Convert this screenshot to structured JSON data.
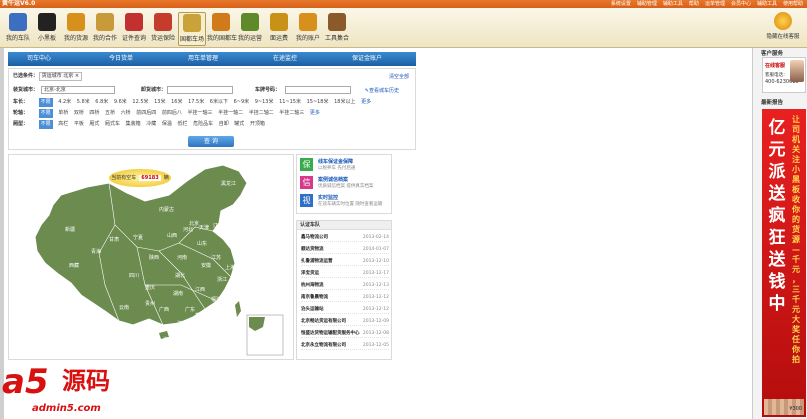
{
  "window": {
    "title": "黄牛运V6.0",
    "menus": [
      "系统设置",
      "辅助管理",
      "辅助工具",
      "帮助",
      "运单管理",
      "会员中心",
      "辅助工具",
      "使用帮助"
    ]
  },
  "toolbar": {
    "items": [
      {
        "label": "我的车队",
        "icon": "truck-team-icon",
        "color": "#3c6fc2"
      },
      {
        "label": "小黑板",
        "icon": "blackboard-icon",
        "color": "#222222"
      },
      {
        "label": "我的货源",
        "icon": "cargo-icon",
        "color": "#d8901c"
      },
      {
        "label": "我的合作",
        "icon": "handshake-icon",
        "color": "#c89a3a"
      },
      {
        "label": "证件查询",
        "icon": "certificate-icon",
        "color": "#c33030"
      },
      {
        "label": "货运保险",
        "icon": "insurance-icon",
        "color": "#c63c2c"
      },
      {
        "label": "国都车场",
        "icon": "parking-icon",
        "color": "#c9a23a"
      },
      {
        "label": "我的国都车",
        "icon": "truck-icon",
        "color": "#d07a1a"
      },
      {
        "label": "我的运营",
        "icon": "operation-icon",
        "color": "#5f8a2a"
      },
      {
        "label": "面运费",
        "icon": "freight-icon",
        "color": "#c89218"
      },
      {
        "label": "我的账户",
        "icon": "account-icon",
        "color": "#d8901c"
      },
      {
        "label": "工具集合",
        "icon": "tools-icon",
        "color": "#8a5a2a"
      }
    ],
    "favorite_label": "隐藏在线客服"
  },
  "tabs": [
    {
      "label": "司车中心",
      "active": false
    },
    {
      "label": "今日货单",
      "active": false
    },
    {
      "label": "用车单管理",
      "active": false
    },
    {
      "label": "在途监控",
      "active": false
    },
    {
      "label": "保证金账户",
      "active": false
    }
  ],
  "filter": {
    "selected_label": "已选条件：",
    "chips": [
      "货运城市",
      "北京"
    ],
    "clear_label": "清空全部",
    "history_label": "查看城车历史",
    "from_label": "装货城市：",
    "from_value": "北京-北京",
    "to_label": "卸货城市：",
    "length_label": "车长：",
    "lengths": [
      "不限",
      "4.2米",
      "5.8米",
      "6.8米",
      "9.6米",
      "12.5米",
      "13米",
      "16米",
      "17.5米",
      "6米以下",
      "6~9米",
      "9~13米",
      "11~15米",
      "15~18米",
      "18米以上"
    ],
    "axle_label": "轮轴：",
    "axles": [
      "不限",
      "单桥",
      "双桥",
      "四桥",
      "五桥",
      "六桥",
      "前四后四",
      "前四后八",
      "半挂一轴三",
      "半挂一轴二",
      "半挂二轴二",
      "半挂二轴三"
    ],
    "body_label": "厢型：",
    "bodies": [
      "不限",
      "高栏",
      "平板",
      "厢式",
      "厢式车",
      "集装箱",
      "冷藏",
      "保温",
      "低栏",
      "危险品车",
      "自卸",
      "罐式",
      "开顶箱"
    ],
    "more_label": "更多",
    "plate_label": "车牌号码：",
    "query_label": "查 询"
  },
  "map": {
    "bubble_prefix": "当前有空车",
    "bubble_count": "69183",
    "bubble_suffix": "辆",
    "land_color": "#6c8b4e",
    "sea_color": "#ffffff",
    "provinces": [
      "新疆",
      "西藏",
      "青海",
      "甘肃",
      "内蒙古",
      "黑龙江",
      "吉林",
      "辽宁",
      "宁夏",
      "陕西",
      "山西",
      "河北",
      "北京",
      "天津",
      "山东",
      "河南",
      "江苏",
      "安徽",
      "湖北",
      "四川",
      "重庆",
      "湖南",
      "江西",
      "浙江",
      "上海",
      "福建",
      "台湾",
      "广东",
      "广西",
      "云南",
      "贵州",
      "海南",
      "香港",
      "澳门"
    ]
  },
  "services": [
    {
      "badge": "保",
      "badge_color": "#3aaa4a",
      "title": "线车保证金保障",
      "desc": "以税养车  先付后通"
    },
    {
      "badge": "信",
      "badge_color": "#d63a8a",
      "title": "案例诚信档案",
      "desc": "优质诚信档案  提供真实档案"
    },
    {
      "badge": "视",
      "badge_color": "#2f6fc8",
      "title": "实时监控",
      "desc": "在途车辆实时位置  随时查看运输"
    }
  ],
  "cert": {
    "header": "认证车队",
    "rows": [
      {
        "name": "鑫马物流公司",
        "date": "2013-02-14"
      },
      {
        "name": "顺达货物流",
        "date": "2014-01-07"
      },
      {
        "name": "扎鲁浦物流运营",
        "date": "2013-12-10"
      },
      {
        "name": "泽宝货运",
        "date": "2013-12-17"
      },
      {
        "name": "杭州海物流",
        "date": "2013-12-13"
      },
      {
        "name": "南京鲁晨物流",
        "date": "2013-12-12"
      },
      {
        "name": "泊头运输站",
        "date": "2013-12-12"
      },
      {
        "name": "北京畅达货运有限公司",
        "date": "2013-12-09"
      },
      {
        "name": "恒盛达货物运输配货服务中心",
        "date": "2013-12-08"
      },
      {
        "name": "北京永立物流有限公司",
        "date": "2013-12-05"
      }
    ]
  },
  "right": {
    "service_header": "客户服务",
    "service_online": "在线客服",
    "service_phone_label": "客服电话：",
    "service_phone": "400-6230018",
    "news_header": "最新报告",
    "ad_big": [
      "亿",
      "元",
      "派",
      "送",
      "疯",
      "狂",
      "送",
      "钱",
      "中"
    ],
    "ad_small": [
      "让",
      "司",
      "机",
      "关",
      "注",
      "小",
      "黑",
      "板",
      "收",
      "你",
      "的",
      "货",
      "源",
      "—",
      "千",
      "元",
      "，",
      "三",
      "千",
      "元",
      "大",
      "奖",
      "任",
      "你",
      "拍"
    ],
    "ad_money": "¥300"
  },
  "watermark": {
    "logo": "a5",
    "text": "源码",
    "domain": "admin5.com"
  }
}
